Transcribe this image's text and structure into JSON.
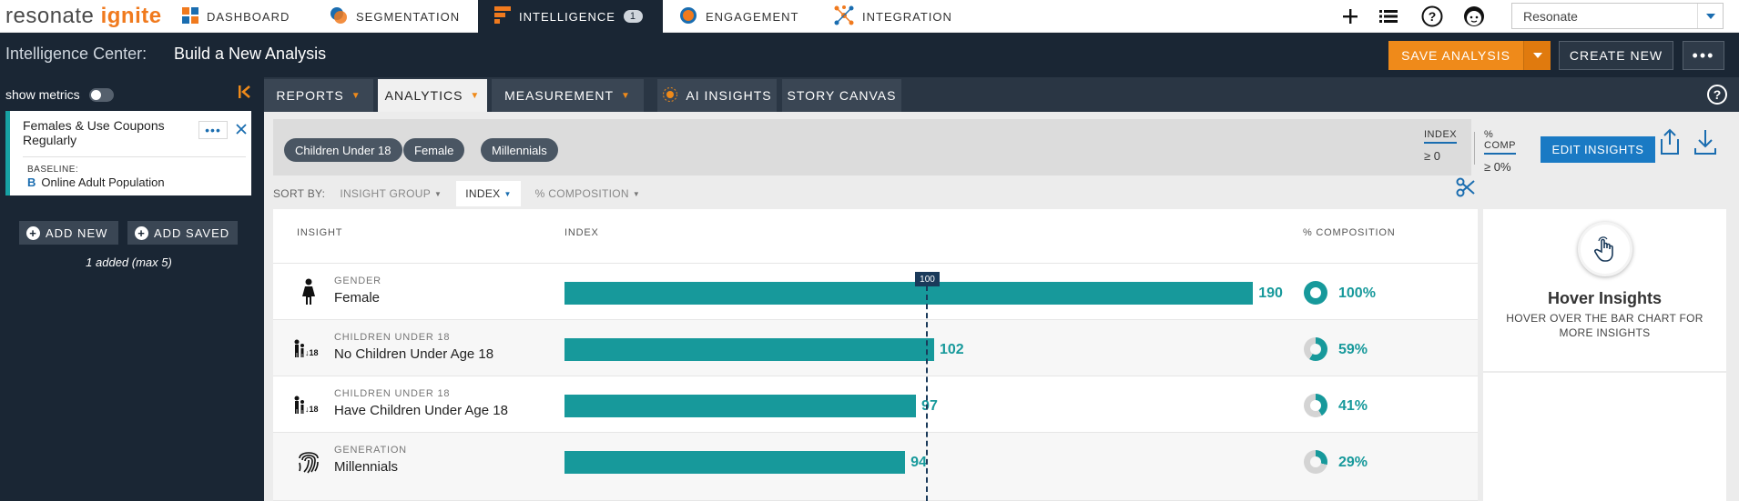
{
  "app": {
    "logo_part1": "resonate",
    "logo_part2": "ignite"
  },
  "nav": {
    "items": [
      {
        "label": "DASHBOARD",
        "icon": "dashboard-grid-icon"
      },
      {
        "label": "SEGMENTATION",
        "icon": "segmentation-icon"
      },
      {
        "label": "INTELLIGENCE",
        "icon": "intelligence-icon",
        "badge": "1",
        "active": true
      },
      {
        "label": "ENGAGEMENT",
        "icon": "engagement-icon"
      },
      {
        "label": "INTEGRATION",
        "icon": "integration-icon"
      }
    ],
    "org_select": "Resonate"
  },
  "header": {
    "breadcrumb": "Intelligence Center:",
    "title": "Build a New Analysis",
    "save_label": "SAVE ANALYSIS",
    "create_label": "CREATE NEW",
    "more_label": "•••"
  },
  "sidebar": {
    "show_metrics": "show metrics",
    "audience": {
      "name": "Females & Use Coupons Regularly",
      "baseline_label": "BASELINE:",
      "baseline_letter": "B",
      "baseline": "Online Adult Population"
    },
    "add_new": "ADD NEW",
    "add_saved": "ADD SAVED",
    "added_note": "1 added (max 5)"
  },
  "tabs": [
    {
      "label": "REPORTS",
      "caret": true
    },
    {
      "label": "ANALYTICS",
      "caret": true,
      "active": true
    },
    {
      "label": "MEASUREMENT",
      "caret": true
    },
    {
      "label": "AI INSIGHTS",
      "icon": "ai-insights-icon"
    },
    {
      "label": "STORY CANVAS"
    }
  ],
  "filters": {
    "chips": [
      "Children Under 18",
      "Female",
      "Millennials"
    ],
    "index_label": "INDEX",
    "index_value": "≥ 0",
    "comp_label": "% COMP",
    "comp_value": "≥ 0%",
    "edit_label": "EDIT INSIGHTS"
  },
  "sort": {
    "label": "SORT BY:",
    "options": [
      "INSIGHT GROUP",
      "INDEX",
      "% COMPOSITION"
    ],
    "active": "INDEX"
  },
  "table": {
    "headers": {
      "insight": "INSIGHT",
      "index": "INDEX",
      "composition": "% COMPOSITION"
    },
    "reference_label": "100",
    "rows": [
      {
        "category": "GENDER",
        "name": "Female",
        "index": 190,
        "index_text": "190",
        "composition": 1.0,
        "composition_text": "100%",
        "icon": "female-person-icon"
      },
      {
        "category": "CHILDREN UNDER 18",
        "name": "No Children Under Age 18",
        "index": 102,
        "index_text": "102",
        "composition": 0.59,
        "composition_text": "59%",
        "icon": "children-icon"
      },
      {
        "category": "CHILDREN UNDER 18",
        "name": "Have Children Under Age 18",
        "index": 97,
        "index_text": "97",
        "composition": 0.41,
        "composition_text": "41%",
        "icon": "children-icon"
      },
      {
        "category": "GENERATION",
        "name": "Millennials",
        "index": 94,
        "index_text": "94",
        "composition": 0.29,
        "composition_text": "29%",
        "icon": "fingerprint-icon"
      }
    ],
    "icon_children_text": "↓18"
  },
  "hover_panel": {
    "title": "Hover Insights",
    "subtitle": "HOVER OVER THE BAR CHART FOR MORE INSIGHTS"
  },
  "colors": {
    "accent_orange": "#ef8a1a",
    "teal": "#17999b",
    "navy": "#1a2634",
    "blue": "#1a7ac4",
    "pie_track": "#d4d4d4"
  }
}
